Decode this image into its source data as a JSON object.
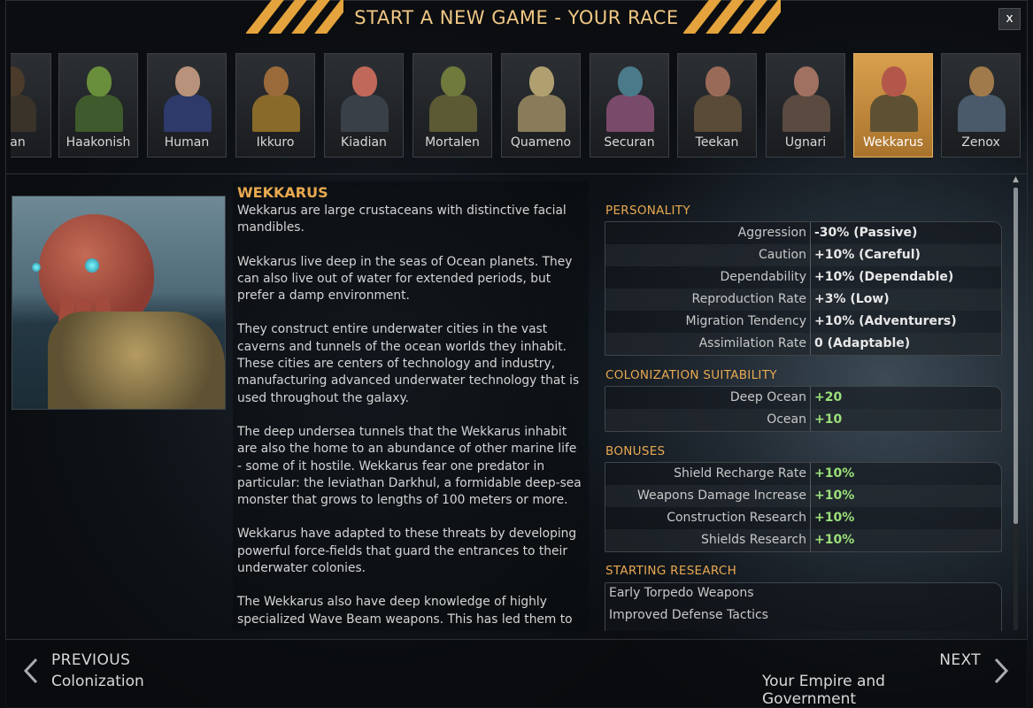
{
  "window": {
    "title": "START A NEW GAME - YOUR RACE",
    "close_label": "x"
  },
  "races": [
    {
      "name": "rean",
      "skin": "#4a3b2a",
      "body": "#3a332a"
    },
    {
      "name": "Haakonish",
      "skin": "#6a8f3c",
      "body": "#3f5a2c"
    },
    {
      "name": "Human",
      "skin": "#b8927a",
      "body": "#2d3a6a"
    },
    {
      "name": "Ikkuro",
      "skin": "#9b6a3a",
      "body": "#8a6a2a"
    },
    {
      "name": "Kiadian",
      "skin": "#c0685a",
      "body": "#3a4048"
    },
    {
      "name": "Mortalen",
      "skin": "#6f7a3c",
      "body": "#5c5a34"
    },
    {
      "name": "Quameno",
      "skin": "#b0a070",
      "body": "#8a7c5a"
    },
    {
      "name": "Securan",
      "skin": "#4b7a8a",
      "body": "#7a4a6a"
    },
    {
      "name": "Teekan",
      "skin": "#9a6a58",
      "body": "#5a4a38"
    },
    {
      "name": "Ugnari",
      "skin": "#a07060",
      "body": "#5a4a40"
    },
    {
      "name": "Wekkarus",
      "skin": "#b3574a",
      "body": "#5e5133"
    },
    {
      "name": "Zenox",
      "skin": "#a07a4a",
      "body": "#4a5a6a"
    }
  ],
  "selected_race": "Wekkarus",
  "description": {
    "heading": "WEKKARUS",
    "paragraphs": [
      "Wekkarus are large crustaceans with distinctive facial mandibles.",
      "Wekkarus live deep in the seas of Ocean planets. They can also live out of water for extended periods, but prefer a damp environment.",
      "They construct entire underwater cities in the vast caverns and tunnels of the ocean worlds they inhabit. These cities are centers of technology and industry, manufacturing advanced underwater technology that is used throughout the galaxy.",
      "The deep undersea tunnels that the Wekkarus inhabit are also the home to an abundance of other marine life - some of it hostile. Wekkarus fear one predator in particular: the leviathan Darkhul, a formidable deep-sea monster that grows to lengths of 100 meters or more.",
      "Wekkarus have adapted to these threats by developing powerful force-fields that guard the entrances to their underwater colonies.",
      "The Wekkarus also have deep knowledge of highly specialized Wave Beam weapons. This has led them to"
    ]
  },
  "personality": {
    "title": "PERSONALITY",
    "rows": [
      {
        "label": "Aggression",
        "value": "-30% (Passive)"
      },
      {
        "label": "Caution",
        "value": "+10% (Careful)"
      },
      {
        "label": "Dependability",
        "value": "+10% (Dependable)"
      },
      {
        "label": "Reproduction Rate",
        "value": "+3% (Low)"
      },
      {
        "label": "Migration Tendency",
        "value": "+10% (Adventurers)"
      },
      {
        "label": "Assimilation Rate",
        "value": "0 (Adaptable)"
      }
    ]
  },
  "colonization": {
    "title": "COLONIZATION SUITABILITY",
    "rows": [
      {
        "label": "Deep Ocean",
        "value": "+20"
      },
      {
        "label": "Ocean",
        "value": "+10"
      }
    ]
  },
  "bonuses": {
    "title": "BONUSES",
    "rows": [
      {
        "label": "Shield Recharge Rate",
        "value": "+10%"
      },
      {
        "label": "Weapons Damage Increase",
        "value": "+10%"
      },
      {
        "label": "Construction Research",
        "value": "+10%"
      },
      {
        "label": "Shields Research",
        "value": "+10%"
      }
    ]
  },
  "starting_research": {
    "title": "STARTING RESEARCH",
    "items": [
      "Early Torpedo Weapons",
      "Improved Defense Tactics"
    ]
  },
  "footer": {
    "prev_top": "PREVIOUS",
    "prev_bottom": "Colonization",
    "next_top": "NEXT",
    "next_bottom": "Your Empire and Government"
  },
  "colors": {
    "accent": "#e9a950",
    "green": "#9be07a",
    "selected": "#d9a04e"
  }
}
